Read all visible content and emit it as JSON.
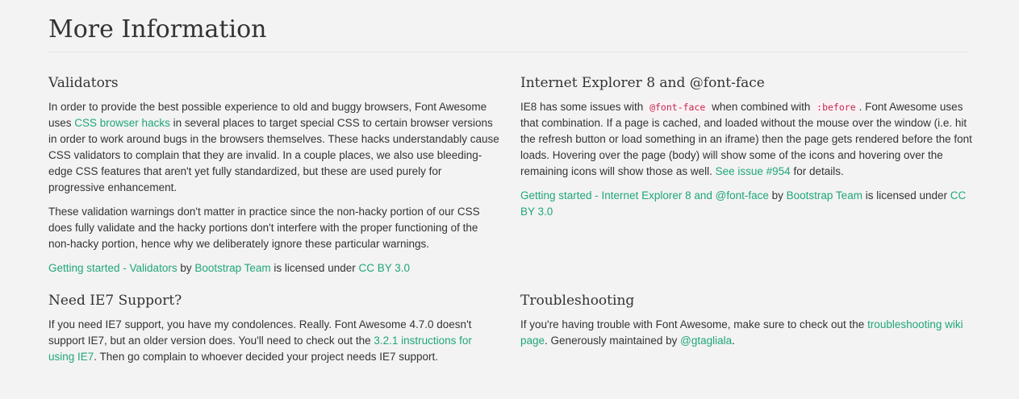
{
  "page": {
    "title": "More Information",
    "link_color": "#1fa67a"
  },
  "validators": {
    "heading": "Validators",
    "p1": {
      "t1": "In order to provide the best possible experience to old and buggy browsers, Font Awesome uses ",
      "link": "CSS browser hacks",
      "t2": " in several places to target special CSS to certain browser versions in order to work around bugs in the browsers themselves. These hacks understandably cause CSS validators to complain that they are invalid. In a couple places, we also use bleeding-edge CSS features that aren't yet fully standardized, but these are used purely for progressive enhancement."
    },
    "p2": "These validation warnings don't matter in practice since the non-hacky portion of our CSS does fully validate and the hacky portions don't interfere with the proper functioning of the non-hacky portion, hence why we deliberately ignore these particular warnings.",
    "attribution": {
      "source_link": "Getting started - Validators",
      "by": " by ",
      "author_link": "Bootstrap Team",
      "licensed": " is licensed under ",
      "license_link": "CC BY 3.0"
    }
  },
  "ie8": {
    "heading": "Internet Explorer 8 and @font-face",
    "p1": {
      "t1": "IE8 has some issues with ",
      "code1": "@font-face",
      "t2": " when combined with ",
      "code2": ":before",
      "t3": ". Font Awesome uses that combination. If a page is cached, and loaded without the mouse over the window (i.e. hit the refresh button or load something in an iframe) then the page gets rendered before the font loads. Hovering over the page (body) will show some of the icons and hovering over the remaining icons will show those as well. ",
      "link": "See issue #954",
      "t4": " for details."
    },
    "attribution": {
      "source_link": "Getting started - Internet Explorer 8 and @font-face",
      "by": " by ",
      "author_link": "Bootstrap Team",
      "licensed": " is licensed under ",
      "license_link": "CC BY 3.0"
    }
  },
  "ie7": {
    "heading": "Need IE7 Support?",
    "p1": {
      "t1": "If you need IE7 support, you have my condolences. Really. Font Awesome 4.7.0 doesn't support IE7, but an older version does. You'll need to check out the ",
      "link": "3.2.1 instructions for using IE7",
      "t2": ". Then go complain to whoever decided your project needs IE7 support."
    }
  },
  "troubleshooting": {
    "heading": "Troubleshooting",
    "p1": {
      "t1": "If you're having trouble with Font Awesome, make sure to check out the ",
      "link": "troubleshooting wiki page",
      "t2": ". Generously maintained by ",
      "link2": "@gtagliala",
      "t3": "."
    }
  }
}
